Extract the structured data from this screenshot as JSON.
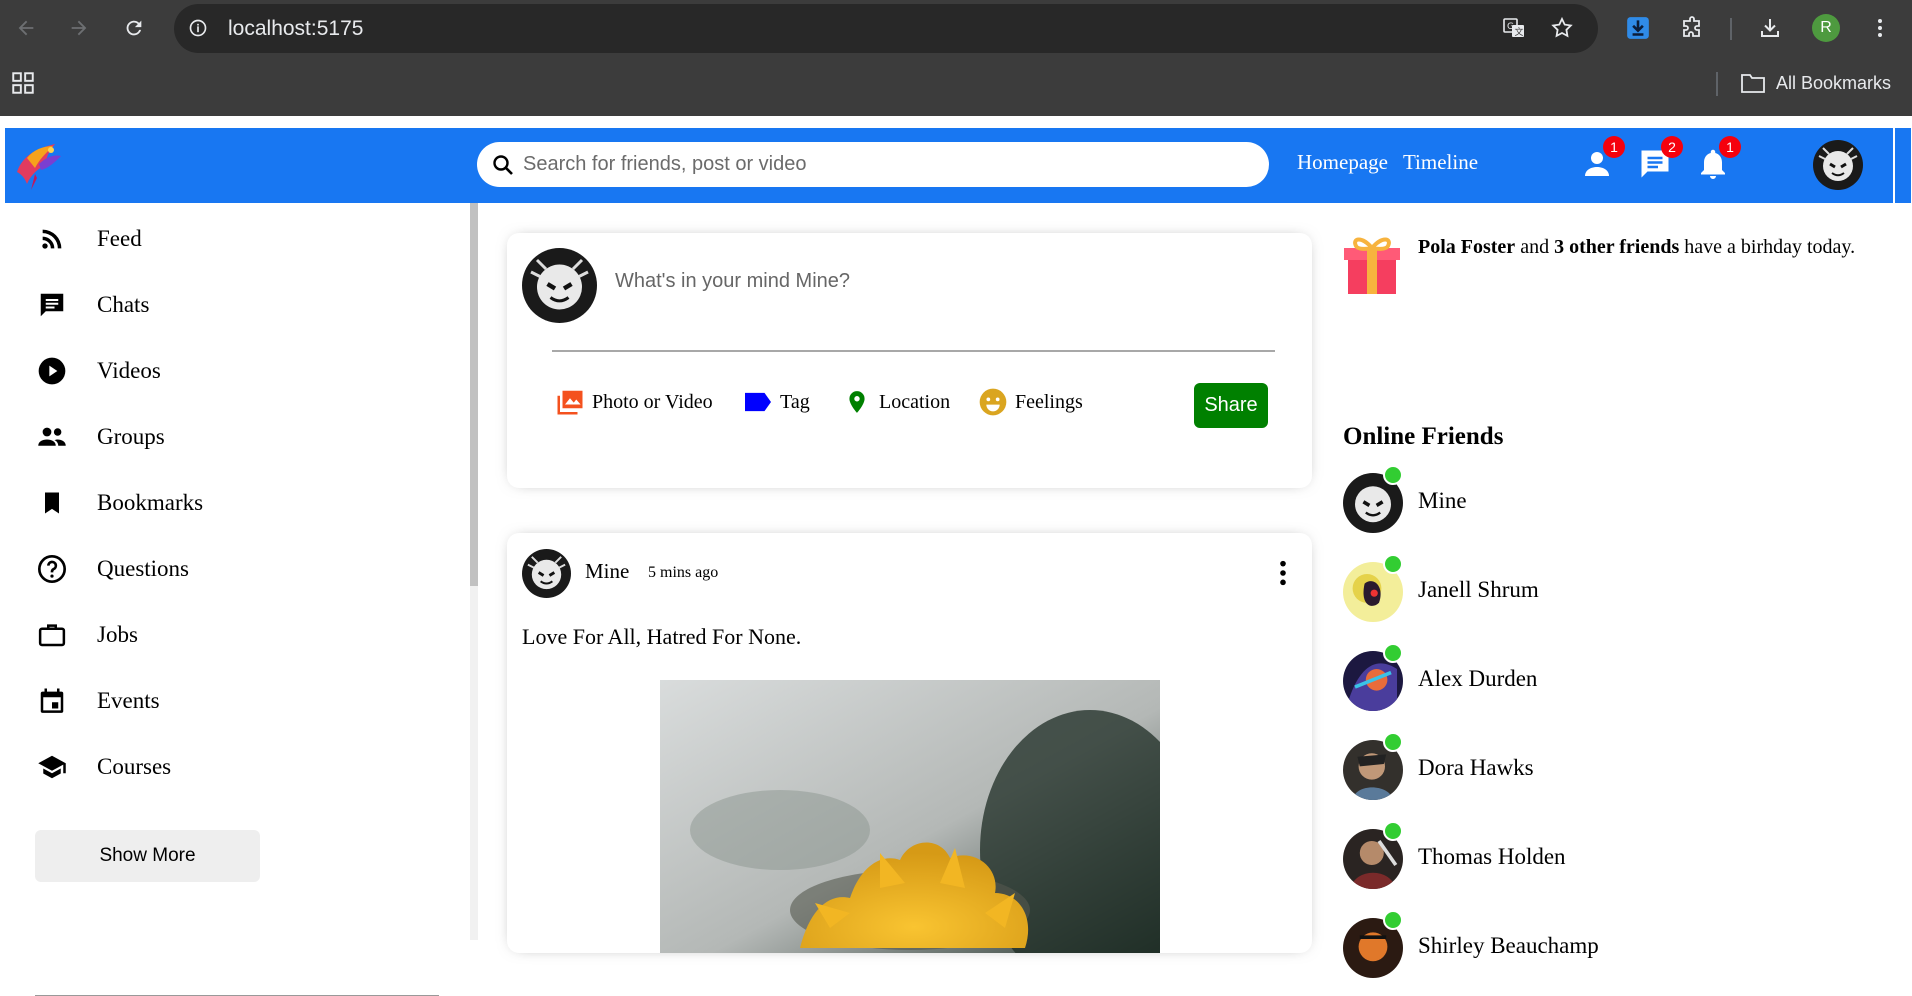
{
  "browser": {
    "url": "localhost:5175",
    "bookmarks_label": "All Bookmarks",
    "profile_initial": "R"
  },
  "topbar": {
    "search_placeholder": "Search for friends, post or video",
    "links": [
      "Homepage",
      "Timeline"
    ],
    "badges": {
      "friend_requests": "1",
      "messages": "2",
      "notifications": "1"
    },
    "brand_color": "#1877f2"
  },
  "sidebar": {
    "items": [
      {
        "label": "Feed",
        "icon": "rss-feed-icon"
      },
      {
        "label": "Chats",
        "icon": "chat-icon"
      },
      {
        "label": "Videos",
        "icon": "play-circle-icon"
      },
      {
        "label": "Groups",
        "icon": "group-icon"
      },
      {
        "label": "Bookmarks",
        "icon": "bookmark-icon"
      },
      {
        "label": "Questions",
        "icon": "help-outline-icon"
      },
      {
        "label": "Jobs",
        "icon": "work-outline-icon"
      },
      {
        "label": "Events",
        "icon": "event-icon"
      },
      {
        "label": "Courses",
        "icon": "school-icon"
      }
    ],
    "show_more_label": "Show More"
  },
  "share": {
    "placeholder": "What's in your mind Mine?",
    "options": [
      {
        "label": "Photo or Video",
        "icon": "photo-library-icon",
        "color": "#f4511e"
      },
      {
        "label": "Tag",
        "icon": "label-icon",
        "color": "#0000ff"
      },
      {
        "label": "Location",
        "icon": "location-pin-icon",
        "color": "#008000"
      },
      {
        "label": "Feelings",
        "icon": "emoji-icon",
        "color": "#daa520"
      }
    ],
    "button_label": "Share",
    "button_color": "#008000"
  },
  "post": {
    "username": "Mine",
    "time": "5 mins ago",
    "text": "Love For All, Hatred For None."
  },
  "birthday": {
    "name": "Pola Foster",
    "middle": " and ",
    "others": "3 other friends",
    "rest": " have a birhday today."
  },
  "online": {
    "title": "Online Friends",
    "friends": [
      "Mine",
      "Janell Shrum",
      "Alex Durden",
      "Dora Hawks",
      "Thomas Holden",
      "Shirley Beauchamp"
    ],
    "dot_color": "#32cd32"
  }
}
